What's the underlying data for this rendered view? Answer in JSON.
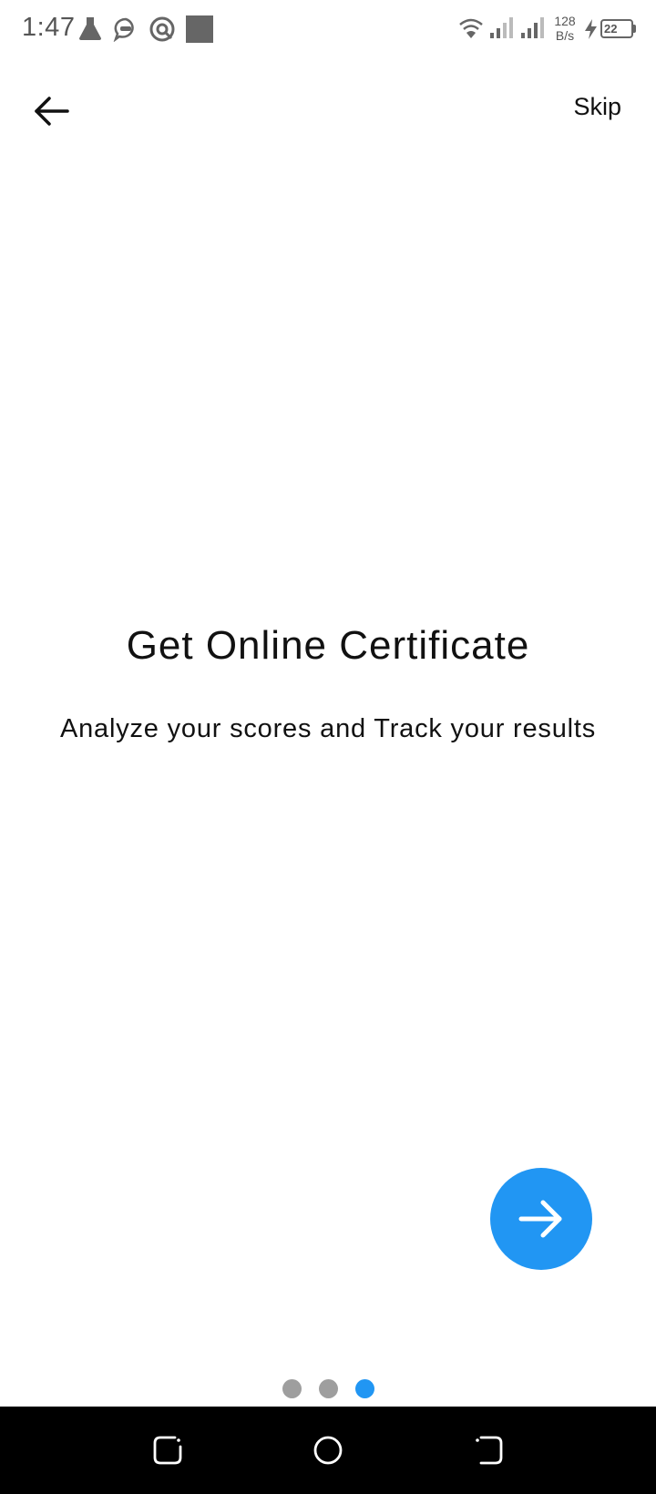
{
  "status_bar": {
    "time": "1:47",
    "net_speed_value": "128",
    "net_speed_unit": "B/s",
    "battery_level": "22"
  },
  "app_bar": {
    "back_icon": "arrow-left-icon",
    "skip_label": "Skip"
  },
  "content": {
    "title": "Get Online Certificate",
    "subtitle": "Analyze your scores and Track your results"
  },
  "next_button": {
    "icon": "arrow-right-icon",
    "color": "#2196F3"
  },
  "page_indicator": {
    "total": 3,
    "active_index": 2,
    "active_color": "#2196F3",
    "inactive_color": "#9E9E9E"
  },
  "nav_bar": {
    "icons": [
      "recents-icon",
      "home-icon",
      "back-icon"
    ]
  }
}
